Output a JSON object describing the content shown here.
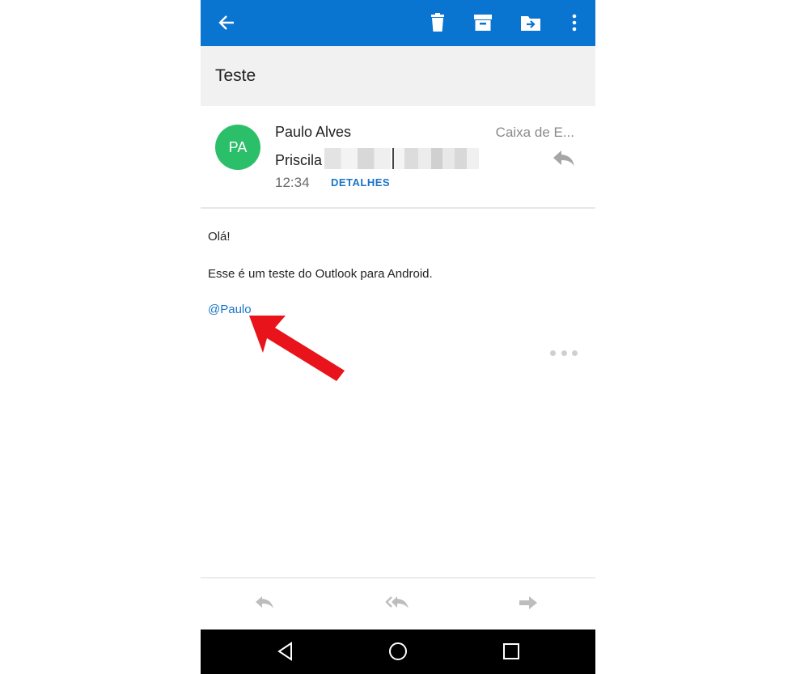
{
  "appbar": {
    "icons": [
      "arrow-back-icon",
      "trash-icon",
      "archive-icon",
      "move-to-folder-icon",
      "more-vert-icon"
    ],
    "color": "#0a74d1"
  },
  "email": {
    "subject": "Teste",
    "avatar_initials": "PA",
    "avatar_color": "#2cbf6a",
    "sender": "Paulo Alves",
    "folder": "Caixa de E...",
    "recipient": "Priscila",
    "time": "12:34",
    "details_label": "DETALHES",
    "body": {
      "greeting": "Olá!",
      "line": "Esse é um teste do Outlook para Android.",
      "mention": "@Paulo"
    }
  },
  "annotation": {
    "type": "red-arrow",
    "color": "#e8131b"
  },
  "bottom_actions": [
    "reply-icon",
    "reply-all-icon",
    "forward-icon"
  ],
  "system_nav": [
    "back-icon",
    "home-icon",
    "recents-icon"
  ]
}
